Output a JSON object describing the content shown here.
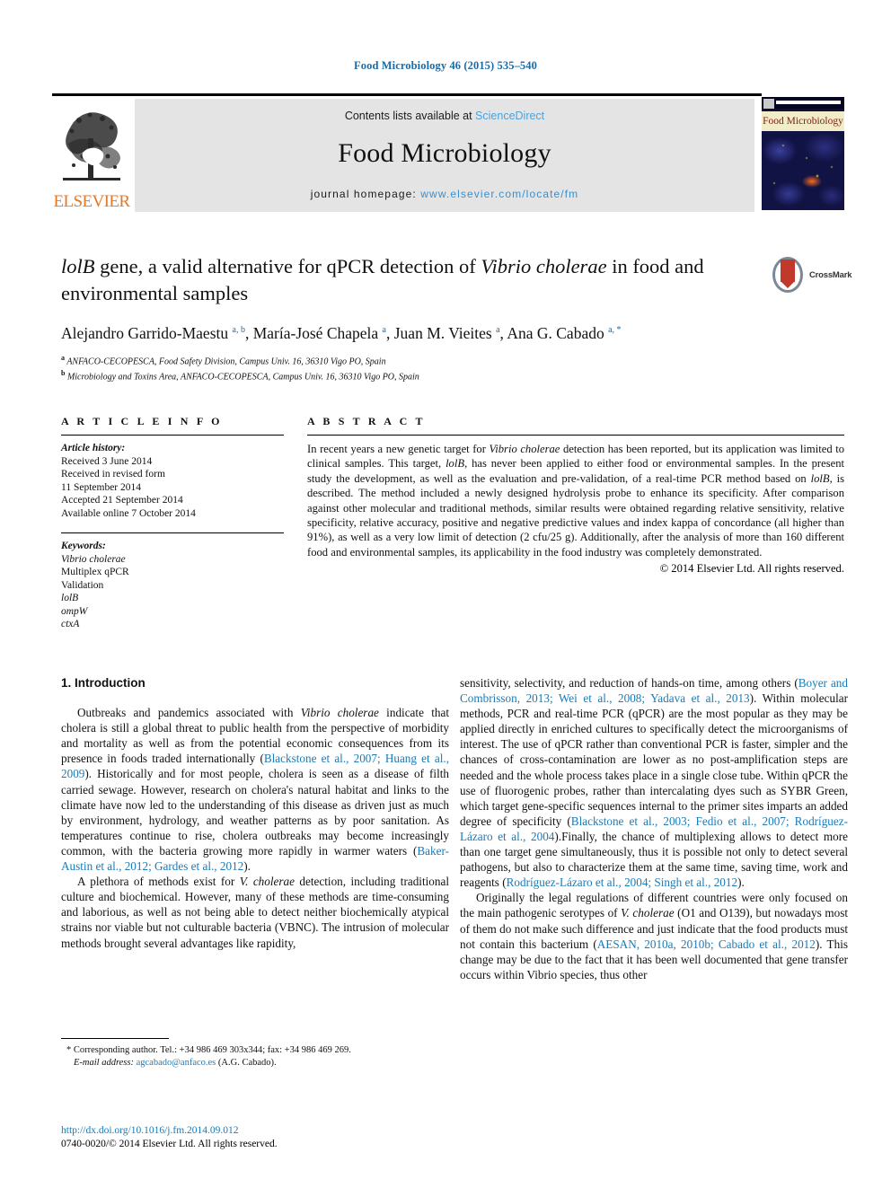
{
  "running_head": "Food Microbiology 46 (2015) 535–540",
  "banner": {
    "contents_prefix": "Contents lists available at ",
    "sciencedirect": "ScienceDirect",
    "journal_title": "Food Microbiology",
    "homepage_prefix": "journal homepage: ",
    "homepage_url": "www.elsevier.com/locate/fm",
    "publisher_wordmark": "ELSEVIER",
    "cover_title": "Food Microbiology",
    "link_color": "#4ba3dd",
    "publisher_color": "#e87722"
  },
  "article": {
    "title_html": "<em>lolB</em> gene, a valid alternative for qPCR detection of <em>Vibrio cholerae</em> in food and environmental samples",
    "authors_html": "Alejandro Garrido-Maestu <sup>a, b</sup>, María-José Chapela <sup>a</sup>, Juan M. Vieites <sup>a</sup>, Ana G. Cabado <sup>a, <span class=\"star\">*</span></sup>",
    "affiliation_a": "ANFACO-CECOPESCA, Food Safety Division, Campus Univ. 16, 36310 Vigo PO, Spain",
    "affiliation_b": "Microbiology and Toxins Area, ANFACO-CECOPESCA, Campus Univ. 16, 36310 Vigo PO, Spain",
    "crossmark_label": "CrossMark"
  },
  "article_info": {
    "heading": "A R T I C L E   I N F O",
    "history_label": "Article history:",
    "history_lines": [
      "Received 3 June 2014",
      "Received in revised form",
      "11 September 2014",
      "Accepted 21 September 2014",
      "Available online 7 October 2014"
    ],
    "keywords_label": "Keywords:",
    "keywords": [
      "Vibrio cholerae",
      "Multiplex qPCR",
      "Validation",
      "lolB",
      "ompW",
      "ctxA"
    ]
  },
  "abstract": {
    "heading": "A B S T R A C T",
    "body_html": "In recent years a new genetic target for <em>Vibrio cholerae</em> detection has been reported, but its application was limited to clinical samples. This target, <em>lolB</em>, has never been applied to either food or environmental samples. In the present study the development, as well as the evaluation and pre-validation, of a real-time PCR method based on <em>lolB</em>, is described. The method included a newly designed hydrolysis probe to enhance its specificity. After comparison against other molecular and traditional methods, similar results were obtained regarding relative sensitivity, relative specificity, relative accuracy, positive and negative predictive values and index kappa of concordance (all higher than 91%), as well as a very low limit of detection (2 cfu/25 g). Additionally, after the analysis of more than 160 different food and environmental samples, its applicability in the food industry was completely demonstrated.",
    "copyright": "© 2014 Elsevier Ltd. All rights reserved."
  },
  "introduction": {
    "section_title": "1. Introduction",
    "left_paragraphs_html": [
      "Outbreaks and pandemics associated with <em>Vibrio cholerae</em> indicate that cholera is still a global threat to public health from the perspective of morbidity and mortality as well as from the potential economic consequences from its presence in foods traded internationally (<span class=\"ref\">Blackstone et al., 2007; Huang et al., 2009</span>). Historically and for most people, cholera is seen as a disease of filth carried sewage. However, research on cholera's natural habitat and links to the climate have now led to the understanding of this disease as driven just as much by environment, hydrology, and weather patterns as by poor sanitation. As temperatures continue to rise, cholera outbreaks may become increasingly common, with the bacteria growing more rapidly in warmer waters (<span class=\"ref\">Baker-Austin et al., 2012; Gardes et al., 2012</span>).",
      "A plethora of methods exist for <em>V. cholerae</em> detection, including traditional culture and biochemical. However, many of these methods are time-consuming and laborious, as well as not being able to detect neither biochemically atypical strains nor viable but not culturable bacteria (VBNC). The intrusion of molecular methods brought several advantages like rapidity,"
    ],
    "right_paragraphs_html": [
      "sensitivity, selectivity, and reduction of hands-on time, among others (<span class=\"ref\">Boyer and Combrisson, 2013; Wei et al., 2008; Yadava et al., 2013</span>). Within molecular methods, PCR and real-time PCR (qPCR) are the most popular as they may be applied directly in enriched cultures to specifically detect the microorganisms of interest. The use of qPCR rather than conventional PCR is faster, simpler and the chances of cross-contamination are lower as no post-amplification steps are needed and the whole process takes place in a single close tube. Within qPCR the use of fluorogenic probes, rather than intercalating dyes such as SYBR Green, which target gene-specific sequences internal to the primer sites imparts an added degree of specificity (<span class=\"ref\">Blackstone et al., 2003; Fedio et al., 2007; Rodríguez-Lázaro et al., 2004</span>).Finally, the chance of multiplexing allows to detect more than one target gene simultaneously, thus it is possible not only to detect several pathogens, but also to characterize them at the same time, saving time, work and reagents (<span class=\"ref\">Rodríguez-Lázaro et al., 2004; Singh et al., 2012</span>).",
      "Originally the legal regulations of different countries were only focused on the main pathogenic serotypes of <em>V. cholerae</em> (O1 and O139), but nowadays most of them do not make such difference and just indicate that the food products must not contain this bacterium (<span class=\"ref\">AESAN, 2010a, 2010b; Cabado et al., 2012</span>). This change may be due to the fact that it has been well documented that gene transfer occurs within Vibrio species, thus other"
    ]
  },
  "footnote": {
    "corresponding_html": "* Corresponding author. Tel.: +34 986 469 303x344; fax: +34 986 469 269.",
    "email_html": "<span class=\"it\">E-mail address:</span> <span class=\"lnk\">agcabado@anfaco.es</span> (A.G. Cabado)."
  },
  "doi": {
    "url": "http://dx.doi.org/10.1016/j.fm.2014.09.012",
    "issn_line": "0740-0020/© 2014 Elsevier Ltd. All rights reserved."
  }
}
